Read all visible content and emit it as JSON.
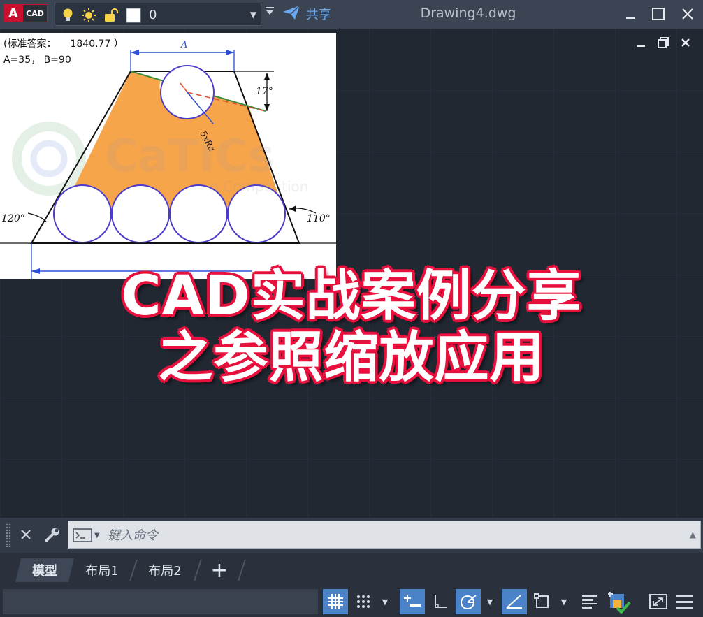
{
  "titlebar": {
    "logo_letter": "A",
    "logo_text": "CAD",
    "layer_name": "0",
    "share_label": "共享",
    "document_title": "Drawing4.dwg",
    "icons": [
      "lightbulb-icon",
      "sun-icon",
      "unlock-icon",
      "color-swatch-icon",
      "dropdown-icon",
      "share-plane-icon",
      "minimize-icon",
      "maximize-icon",
      "close-icon"
    ]
  },
  "reference_image": {
    "standard_answer_label": "(标准答案：",
    "standard_answer_value": "1840.77 ）",
    "params": "A=35， B=90",
    "dim_a": "A",
    "angle_top": "17°",
    "radius_label": "5xRa",
    "angle_left": "120°",
    "angle_right": "110°",
    "watermark": "CaTICs",
    "watermark_sub": "n Competition",
    "colors": {
      "fill": "#f7a54a",
      "circle": "#4b3cc8",
      "dimension": "#2b4fd6",
      "centerline": "#e8503a",
      "slope": "#3c8a3c"
    }
  },
  "caption": {
    "line1": "CAD实战案例分享",
    "line2": "之参照缩放应用",
    "color_outline": "#e8103c"
  },
  "command": {
    "placeholder": "键入命令"
  },
  "tabs": {
    "model": "模型",
    "layout1": "布局1",
    "layout2": "布局2",
    "add": "+"
  },
  "statusbar": {
    "icons": [
      "grid-icon",
      "snap-icon",
      "infer-constraints-icon",
      "ortho-icon",
      "polar-icon",
      "isodraft-icon",
      "object-snap-icon",
      "lineweight-icon",
      "workspace-icon",
      "fullscreen-icon",
      "customize-menu-icon"
    ]
  }
}
